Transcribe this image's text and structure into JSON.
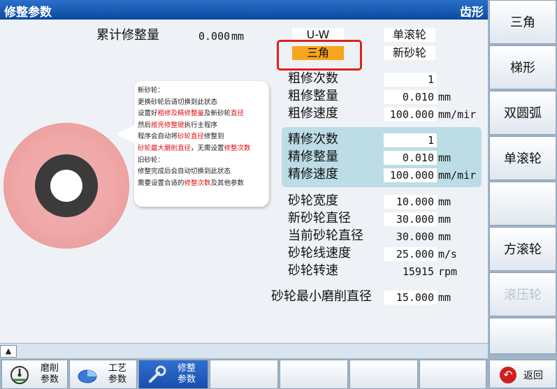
{
  "title": {
    "left": "修整参数",
    "right": "齿形"
  },
  "header": {
    "total_label": "累计修整量",
    "total_value": "0.000",
    "total_unit": "mm"
  },
  "selectors": {
    "shape_top": "U-W",
    "shape_selected": "三角",
    "roller_top": "单滚轮",
    "roller_bottom": "新砂轮"
  },
  "rough": {
    "count_label": "粗修次数",
    "count_value": "1",
    "amount_label": "粗修整量",
    "amount_value": "0.010",
    "amount_unit": "mm",
    "speed_label": "粗修速度",
    "speed_value": "100.000",
    "speed_unit": "mm/mir"
  },
  "fine": {
    "count_label": "精修次数",
    "count_value": "1",
    "amount_label": "精修整量",
    "amount_value": "0.010",
    "amount_unit": "mm",
    "speed_label": "精修速度",
    "speed_value": "100.000",
    "speed_unit": "mm/mir"
  },
  "wheel": {
    "width_label": "砂轮宽度",
    "width_value": "10.000",
    "width_unit": "mm",
    "new_dia_label": "新砂轮直径",
    "new_dia_value": "30.000",
    "new_dia_unit": "mm",
    "cur_dia_label": "当前砂轮直径",
    "cur_dia_value": "30.000",
    "cur_dia_unit": "mm",
    "line_speed_label": "砂轮线速度",
    "line_speed_value": "25.000",
    "line_speed_unit": "m/s",
    "rpm_label": "砂轮转速",
    "rpm_value": "15915",
    "rpm_unit": "rpm",
    "min_dia_label": "砂轮最小磨削直径",
    "min_dia_value": "15.000",
    "min_dia_unit": "mm"
  },
  "note": {
    "l1": "新砂轮：",
    "l2": "更换砂轮后请切换到此状态",
    "l3a": "设置好",
    "l3b": "粗修及精修整量",
    "l3c": "及新砂轮",
    "l3d": "直径",
    "l4a": "然后",
    "l4b": "按亮修整键",
    "l4c": "执行主程序",
    "l5a": "程序会自动将",
    "l5b": "砂轮直径",
    "l5c": "修整到",
    "l6a": "砂轮最大磨削直径",
    "l6b": "，无需设置",
    "l6c": "修整次数",
    "l7": "旧砂轮：",
    "l8": "修整完成后会自动切换到此状态",
    "l9a": "需要设置合适的",
    "l9b": "修整次数",
    "l9c": "及其他参数"
  },
  "right_softkeys": [
    "三角",
    "梯形",
    "双圆弧",
    "单滚轮",
    "",
    "方滚轮",
    "滚压轮",
    ""
  ],
  "back_label": "返回",
  "bottom_softkeys": [
    {
      "line1": "磨削",
      "line2": "参数",
      "icon": "gauge-icon"
    },
    {
      "line1": "工艺",
      "line2": "参数",
      "icon": "pie-icon"
    },
    {
      "line1": "修整",
      "line2": "参数",
      "icon": "wrench-icon"
    }
  ],
  "scroll_glyph": "▲"
}
